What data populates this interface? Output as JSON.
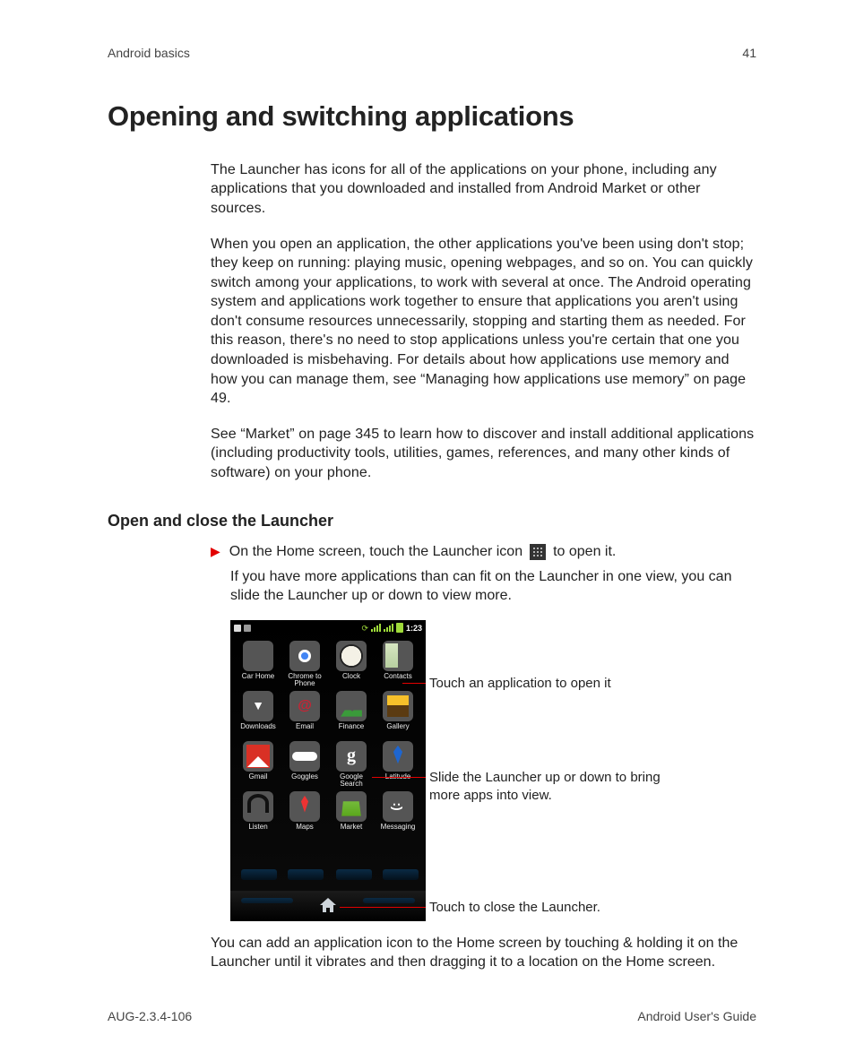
{
  "header": {
    "section": "Android basics",
    "page_number": "41"
  },
  "title": "Opening and switching applications",
  "paragraphs": {
    "p1": "The Launcher has icons for all of the applications on your phone, including any applications that you downloaded and installed from Android Market or other sources.",
    "p2": "When you open an application, the other applications you've been using don't stop; they keep on running: playing music, opening webpages, and so on. You can quickly switch among your applications, to work with several at once. The Android operating system and applications work together to ensure that applications you aren't using don't consume resources unnecessarily, stopping and starting them as needed. For this reason, there's no need to stop applications unless you're certain that one you downloaded is misbehaving. For details about how applications use memory and how you can manage them, see “Managing how applications use memory” on page 49.",
    "p3": "See “Market” on page 345 to learn how to discover and install additional applications (including productivity tools, utilities, games, references, and many other kinds of software) on your phone."
  },
  "subheading": "Open and close the Launcher",
  "step": {
    "pre": "On the Home screen, touch the Launcher icon",
    "post": "to open it.",
    "followup": "If you have more applications than can fit on the Launcher in one view, you can slide the Launcher up or down to view more.",
    "after_figure": "You can add an application icon to the Home screen by touching & holding it on the Launcher until it vibrates and then dragging it to a location on the Home screen."
  },
  "phone": {
    "time": "1:23",
    "apps": [
      {
        "label": "Car Home",
        "cls": "ic-car"
      },
      {
        "label": "Chrome to\nPhone",
        "cls": "ic-chrome"
      },
      {
        "label": "Clock",
        "cls": "ic-clock"
      },
      {
        "label": "Contacts",
        "cls": "ic-contacts"
      },
      {
        "label": "Downloads",
        "cls": "ic-dl"
      },
      {
        "label": "Email",
        "cls": "ic-email"
      },
      {
        "label": "Finance",
        "cls": "ic-finance"
      },
      {
        "label": "Gallery",
        "cls": "ic-gallery"
      },
      {
        "label": "Gmail",
        "cls": "ic-gmail"
      },
      {
        "label": "Goggles",
        "cls": "ic-goggles"
      },
      {
        "label": "Google\nSearch",
        "cls": "ic-gsearch"
      },
      {
        "label": "Latitude",
        "cls": "ic-latitude"
      },
      {
        "label": "Listen",
        "cls": "ic-listen"
      },
      {
        "label": "Maps",
        "cls": "ic-maps"
      },
      {
        "label": "Market",
        "cls": "ic-market"
      },
      {
        "label": "Messaging",
        "cls": "ic-msg"
      }
    ]
  },
  "callouts": {
    "c1": "Touch an application to open it",
    "c2": "Slide the Launcher up or down to bring more apps into view.",
    "c3": "Touch to close the Launcher."
  },
  "footer": {
    "doc_id": "AUG-2.3.4-106",
    "doc_title": "Android User's Guide"
  }
}
